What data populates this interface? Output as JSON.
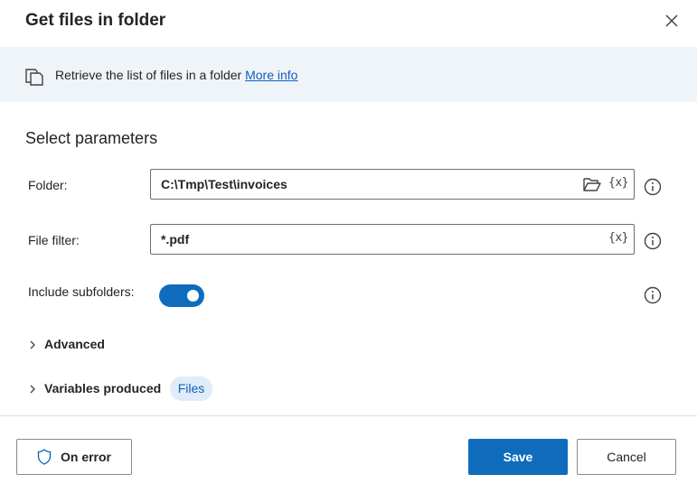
{
  "dialog": {
    "title": "Get files in folder",
    "close_icon": "close-icon"
  },
  "info": {
    "icon": "copy-document-icon",
    "text": "Retrieve the list of files in a folder ",
    "link": "More info"
  },
  "section": {
    "title": "Select parameters"
  },
  "params": {
    "folder": {
      "label": "Folder:",
      "value": "C:\\Tmp\\Test\\invoices",
      "var_glyph": "{x}"
    },
    "file_filter": {
      "label": "File filter:",
      "value": "*.pdf",
      "var_glyph": "{x}"
    },
    "include_subfolders": {
      "label": "Include subfolders:",
      "enabled": true
    }
  },
  "advanced": {
    "label": "Advanced"
  },
  "variables": {
    "label": "Variables produced",
    "badge": "Files"
  },
  "footer": {
    "on_error": "On error",
    "save": "Save",
    "cancel": "Cancel"
  },
  "colors": {
    "accent": "#0f6cbd",
    "banner_bg": "#eff4f9",
    "link": "#0f5fc0"
  }
}
